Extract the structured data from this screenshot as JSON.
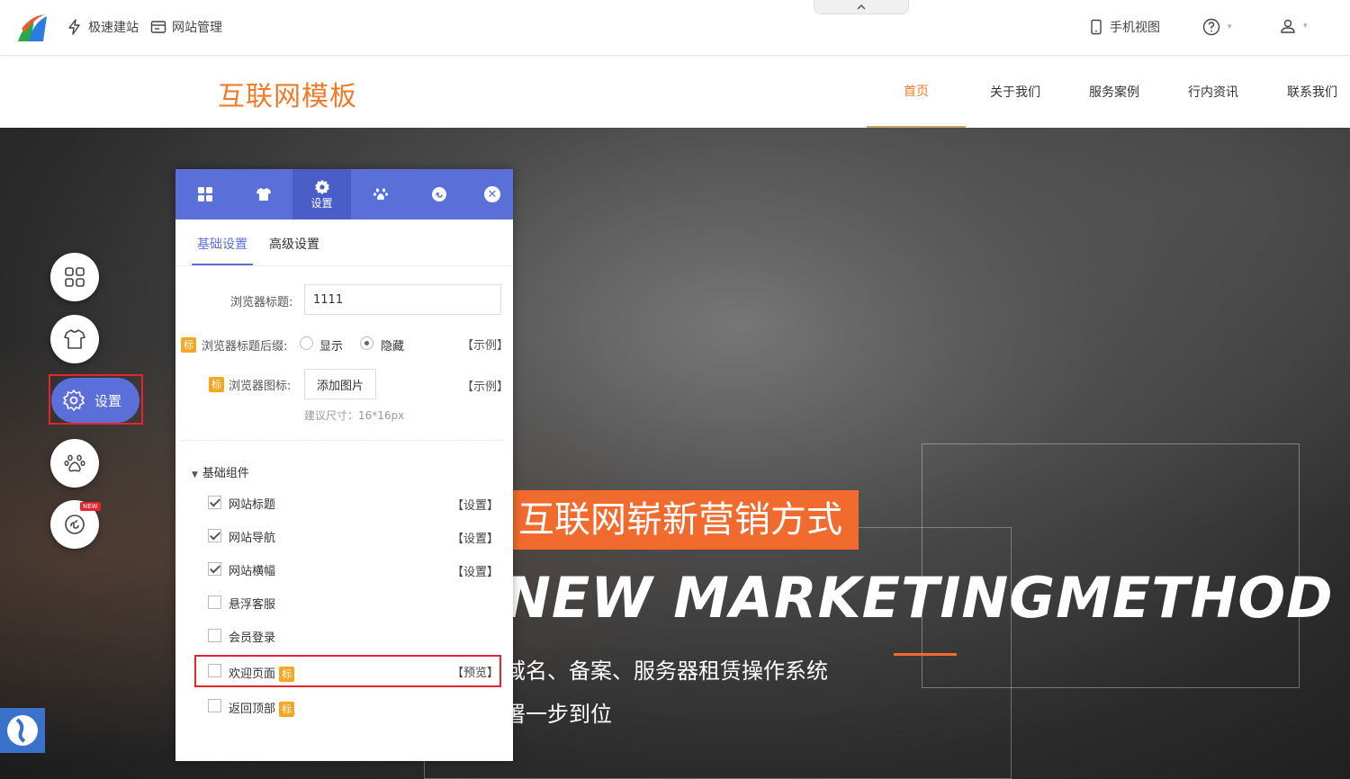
{
  "toolbar": {
    "quick_build": "极速建站",
    "site_manage": "网站管理",
    "mobile_view": "手机视图"
  },
  "site": {
    "title": "互联网模板",
    "nav": [
      "首页",
      "关于我们",
      "服务案例",
      "行内资讯",
      "联系我们"
    ]
  },
  "banner": {
    "slogan_cn": "互联网崭新营销方式",
    "slogan_en": "NEW MARKETINGMETHOD",
    "line1": "域名、备案、服务器租赁操作系统",
    "line2": "署一步到位"
  },
  "float_menu": {
    "settings_label": "设置",
    "new_badge": "NEW"
  },
  "panel": {
    "active_tab_label": "设置",
    "subtabs": [
      "基础设置",
      "高级设置"
    ],
    "browser_title_label": "浏览器标题:",
    "browser_title_value": "1111",
    "suffix_label": "浏览器标题后缀:",
    "suffix_options": [
      "显示",
      "隐藏"
    ],
    "suffix_selected": "隐藏",
    "example_label": "【示例】",
    "icon_label": "浏览器图标:",
    "add_image": "添加图片",
    "size_hint": "建议尺寸：16*16px",
    "badge_text": "标",
    "group_title": "基础组件",
    "components": [
      {
        "label": "网站标题",
        "checked": true,
        "action": "【设置】"
      },
      {
        "label": "网站导航",
        "checked": true,
        "action": "【设置】"
      },
      {
        "label": "网站横幅",
        "checked": true,
        "action": "【设置】"
      },
      {
        "label": "悬浮客服",
        "checked": false,
        "action": ""
      },
      {
        "label": "会员登录",
        "checked": false,
        "action": ""
      },
      {
        "label": "欢迎页面",
        "checked": false,
        "action": "【预览】"
      },
      {
        "label": "返回顶部",
        "checked": false,
        "action": ""
      }
    ]
  },
  "colors": {
    "accent": "#5b6fd8",
    "orange": "#f26b2e",
    "badge": "#f5a623",
    "highlight": "#e5242e"
  }
}
